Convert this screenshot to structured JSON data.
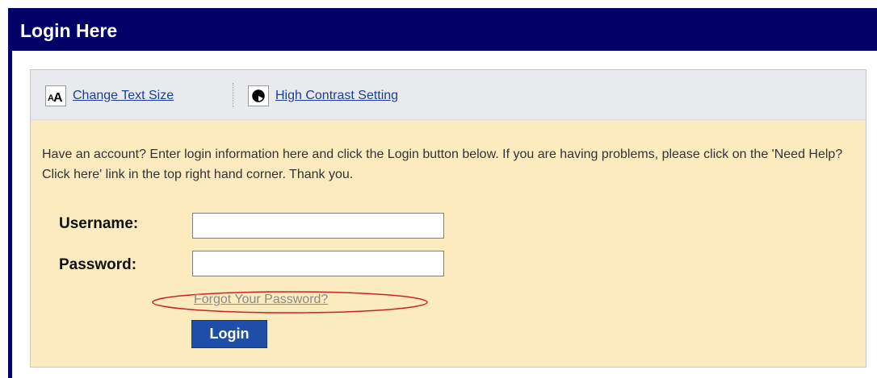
{
  "header": {
    "title": "Login Here"
  },
  "toolbar": {
    "text_size_label": "Change Text Size",
    "contrast_label": "High Contrast Setting"
  },
  "intro": {
    "text": "Have an account? Enter login information here and click the Login button below. If you are having problems, please click on the 'Need Help? Click here' link in the top right hand corner. Thank you."
  },
  "form": {
    "username_label": "Username:",
    "username_value": "",
    "password_label": "Password:",
    "password_value": "",
    "forgot_label": "Forgot Your Password?",
    "login_label": "Login"
  },
  "colors": {
    "title_bar": "#000066",
    "panel_background": "#fdebc0",
    "toolbar_background": "#e9eaed",
    "link": "#1a3e9a",
    "button": "#1f4ea8",
    "annotation_ellipse": "#cc2222"
  },
  "icons": {
    "text_size": "text-size-icon",
    "contrast": "contrast-icon"
  }
}
